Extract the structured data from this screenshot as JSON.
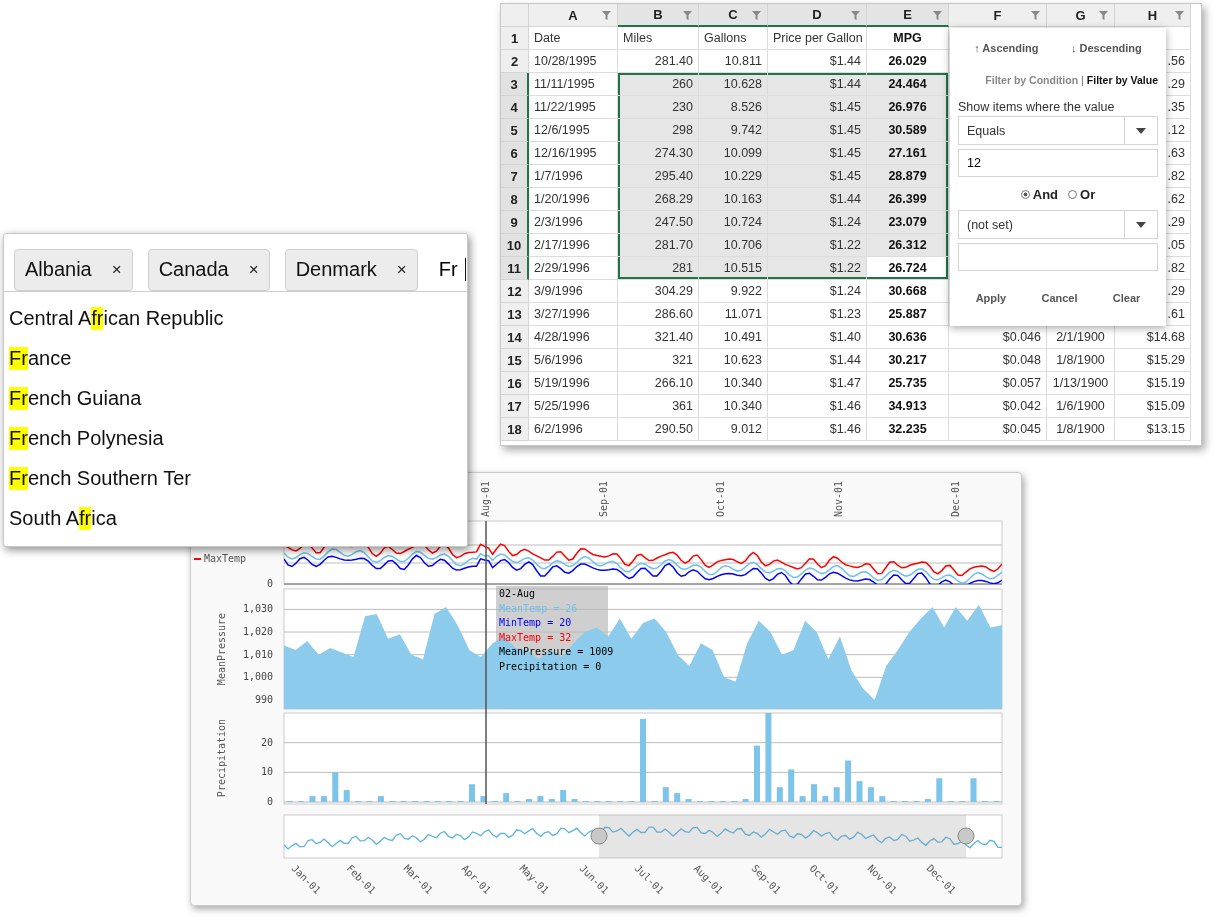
{
  "sheet": {
    "columns": [
      {
        "label": "A",
        "selected": false,
        "bold": false
      },
      {
        "label": "B",
        "selected": true,
        "bold": false
      },
      {
        "label": "C",
        "selected": true,
        "bold": false
      },
      {
        "label": "D",
        "selected": true,
        "bold": false
      },
      {
        "label": "E",
        "selected": true,
        "bold": true
      },
      {
        "label": "F",
        "selected": false,
        "bold": false
      },
      {
        "label": "G",
        "selected": false,
        "bold": false
      },
      {
        "label": "H",
        "selected": false,
        "bold": false
      }
    ],
    "rows": [
      {
        "header": "1",
        "selected": false,
        "cells": [
          {
            "text": "Date",
            "selected": false
          },
          {
            "text": "Miles",
            "selected": false
          },
          {
            "text": "Gallons",
            "selected": false
          },
          {
            "text": "Price per Gallon",
            "selected": false
          },
          {
            "text": "MPG",
            "selected": false
          },
          null,
          null,
          null
        ]
      },
      {
        "header": "2",
        "selected": false,
        "cells": [
          {
            "text": "10/28/1995",
            "selected": false
          },
          {
            "text": "281.40",
            "selected": false
          },
          {
            "text": "10.811",
            "selected": false
          },
          {
            "text": "$1.44",
            "selected": false
          },
          {
            "text": "26.029",
            "selected": false
          },
          null,
          null,
          {
            "text": ".56",
            "selected": false
          }
        ]
      },
      {
        "header": "3",
        "selected": true,
        "cells": [
          {
            "text": "11/11/1995",
            "selected": false
          },
          {
            "text": "260",
            "selected": true
          },
          {
            "text": "10.628",
            "selected": true
          },
          {
            "text": "$1.44",
            "selected": true
          },
          {
            "text": "24.464",
            "selected": true
          },
          null,
          null,
          {
            "text": ".29",
            "selected": false
          }
        ]
      },
      {
        "header": "4",
        "selected": true,
        "cells": [
          {
            "text": "11/22/1995",
            "selected": false
          },
          {
            "text": "230",
            "selected": true
          },
          {
            "text": "8.526",
            "selected": true
          },
          {
            "text": "$1.45",
            "selected": true
          },
          {
            "text": "26.976",
            "selected": true
          },
          null,
          null,
          {
            "text": ".35",
            "selected": false
          }
        ]
      },
      {
        "header": "5",
        "selected": true,
        "cells": [
          {
            "text": "12/6/1995",
            "selected": false
          },
          {
            "text": "298",
            "selected": true
          },
          {
            "text": "9.742",
            "selected": true
          },
          {
            "text": "$1.45",
            "selected": true
          },
          {
            "text": "30.589",
            "selected": true
          },
          null,
          null,
          {
            "text": ".12",
            "selected": false
          }
        ]
      },
      {
        "header": "6",
        "selected": true,
        "cells": [
          {
            "text": "12/16/1995",
            "selected": false
          },
          {
            "text": "274.30",
            "selected": true
          },
          {
            "text": "10.099",
            "selected": true
          },
          {
            "text": "$1.45",
            "selected": true
          },
          {
            "text": "27.161",
            "selected": true
          },
          null,
          null,
          {
            "text": ".63",
            "selected": false
          }
        ]
      },
      {
        "header": "7",
        "selected": true,
        "cells": [
          {
            "text": "1/7/1996",
            "selected": false
          },
          {
            "text": "295.40",
            "selected": true
          },
          {
            "text": "10.229",
            "selected": true
          },
          {
            "text": "$1.45",
            "selected": true
          },
          {
            "text": "28.879",
            "selected": true
          },
          null,
          null,
          {
            "text": ".82",
            "selected": false
          }
        ]
      },
      {
        "header": "8",
        "selected": true,
        "cells": [
          {
            "text": "1/20/1996",
            "selected": false
          },
          {
            "text": "268.29",
            "selected": true
          },
          {
            "text": "10.163",
            "selected": true
          },
          {
            "text": "$1.44",
            "selected": true
          },
          {
            "text": "26.399",
            "selected": true
          },
          null,
          null,
          {
            "text": ".62",
            "selected": false
          }
        ]
      },
      {
        "header": "9",
        "selected": true,
        "cells": [
          {
            "text": "2/3/1996",
            "selected": false
          },
          {
            "text": "247.50",
            "selected": true
          },
          {
            "text": "10.724",
            "selected": true
          },
          {
            "text": "$1.24",
            "selected": true
          },
          {
            "text": "23.079",
            "selected": true
          },
          null,
          null,
          {
            "text": ".29",
            "selected": false
          }
        ]
      },
      {
        "header": "10",
        "selected": true,
        "cells": [
          {
            "text": "2/17/1996",
            "selected": false
          },
          {
            "text": "281.70",
            "selected": true
          },
          {
            "text": "10.706",
            "selected": true
          },
          {
            "text": "$1.22",
            "selected": true
          },
          {
            "text": "26.312",
            "selected": true
          },
          null,
          null,
          {
            "text": ".05",
            "selected": false
          }
        ]
      },
      {
        "header": "11",
        "selected": true,
        "cells": [
          {
            "text": "2/29/1996",
            "selected": false
          },
          {
            "text": "281",
            "selected": true
          },
          {
            "text": "10.515",
            "selected": true
          },
          {
            "text": "$1.22",
            "selected": true
          },
          {
            "text": "26.724",
            "selected": false
          },
          null,
          null,
          {
            "text": ".82",
            "selected": false
          }
        ]
      },
      {
        "header": "12",
        "selected": false,
        "cells": [
          {
            "text": "3/9/1996",
            "selected": false
          },
          {
            "text": "304.29",
            "selected": false
          },
          {
            "text": "9.922",
            "selected": false
          },
          {
            "text": "$1.24",
            "selected": false
          },
          {
            "text": "30.668",
            "selected": false
          },
          null,
          null,
          {
            "text": ".29",
            "selected": false
          }
        ]
      },
      {
        "header": "13",
        "selected": false,
        "cells": [
          {
            "text": "3/27/1996",
            "selected": false
          },
          {
            "text": "286.60",
            "selected": false
          },
          {
            "text": "11.071",
            "selected": false
          },
          {
            "text": "$1.23",
            "selected": false
          },
          {
            "text": "25.887",
            "selected": false
          },
          null,
          null,
          {
            "text": ".61",
            "selected": false
          }
        ]
      },
      {
        "header": "14",
        "selected": false,
        "cells": [
          {
            "text": "4/28/1996",
            "selected": false
          },
          {
            "text": "321.40",
            "selected": false
          },
          {
            "text": "10.491",
            "selected": false
          },
          {
            "text": "$1.40",
            "selected": false
          },
          {
            "text": "30.636",
            "selected": false
          },
          {
            "text": "$0.046",
            "selected": false
          },
          {
            "text": "2/1/1900",
            "selected": false
          },
          {
            "text": "$14.68",
            "selected": false
          }
        ]
      },
      {
        "header": "15",
        "selected": false,
        "cells": [
          {
            "text": "5/6/1996",
            "selected": false
          },
          {
            "text": "321",
            "selected": false
          },
          {
            "text": "10.623",
            "selected": false
          },
          {
            "text": "$1.44",
            "selected": false
          },
          {
            "text": "30.217",
            "selected": false
          },
          {
            "text": "$0.048",
            "selected": false
          },
          {
            "text": "1/8/1900",
            "selected": false
          },
          {
            "text": "$15.29",
            "selected": false
          }
        ]
      },
      {
        "header": "16",
        "selected": false,
        "cells": [
          {
            "text": "5/19/1996",
            "selected": false
          },
          {
            "text": "266.10",
            "selected": false
          },
          {
            "text": "10.340",
            "selected": false
          },
          {
            "text": "$1.47",
            "selected": false
          },
          {
            "text": "25.735",
            "selected": false
          },
          {
            "text": "$0.057",
            "selected": false
          },
          {
            "text": "1/13/1900",
            "selected": false
          },
          {
            "text": "$15.19",
            "selected": false
          }
        ]
      },
      {
        "header": "17",
        "selected": false,
        "cells": [
          {
            "text": "5/25/1996",
            "selected": false
          },
          {
            "text": "361",
            "selected": false
          },
          {
            "text": "10.340",
            "selected": false
          },
          {
            "text": "$1.46",
            "selected": false
          },
          {
            "text": "34.913",
            "selected": false
          },
          {
            "text": "$0.042",
            "selected": false
          },
          {
            "text": "1/6/1900",
            "selected": false
          },
          {
            "text": "$15.09",
            "selected": false
          }
        ]
      },
      {
        "header": "18",
        "selected": false,
        "cells": [
          {
            "text": "6/2/1996",
            "selected": false
          },
          {
            "text": "290.50",
            "selected": false
          },
          {
            "text": "9.012",
            "selected": false
          },
          {
            "text": "$1.46",
            "selected": false
          },
          {
            "text": "32.235",
            "selected": false
          },
          {
            "text": "$0.045",
            "selected": false
          },
          {
            "text": "1/8/1900",
            "selected": false
          },
          {
            "text": "$13.15",
            "selected": false
          }
        ]
      }
    ]
  },
  "filter": {
    "sort": [
      "↑ Ascending",
      "↓ Descending"
    ],
    "tabs": [
      {
        "label": "Filter by Condition",
        "selected": false
      },
      {
        "label": "Filter by Value",
        "selected": true
      }
    ],
    "tab_separator": "|",
    "prompt": "Show items where the value",
    "condition": "Equals",
    "value": "12",
    "operators": [
      {
        "label": "And",
        "selected": true
      },
      {
        "label": "Or",
        "selected": false
      }
    ],
    "second_condition": "(not set)",
    "buttons": [
      "Apply",
      "Cancel",
      "Clear"
    ]
  },
  "tag_input": {
    "tags": [
      {
        "label": "Albania",
        "remove": "×"
      },
      {
        "label": "Canada",
        "remove": "×"
      },
      {
        "label": "Denmark",
        "remove": "×"
      }
    ],
    "value": "Fr",
    "suggestions": [
      {
        "before": "Central A",
        "match": "fr",
        "after": "ican Republic"
      },
      {
        "match": "Fr",
        "after": "ance"
      },
      {
        "match": "Fr",
        "after": "ench Guiana"
      },
      {
        "match": "Fr",
        "after": "ench Polynesia"
      },
      {
        "match": "Fr",
        "after": "ench Southern Ter"
      },
      {
        "before": "South A",
        "match": "fr",
        "after": "ica"
      }
    ]
  },
  "chart_panel": {
    "month_labels": [
      "Aug-01",
      "Sep-01",
      "Oct-01",
      "Nov-01",
      "Dec-01"
    ],
    "temperature": {
      "zero_tick": "0",
      "legend": [
        {
          "name": "MaxTemp",
          "color": "#ff0000"
        }
      ]
    },
    "tooltip": {
      "title": "02-Aug",
      "lines": [
        {
          "text": "MeanTemp = 26",
          "color": "#6ec1ea"
        },
        {
          "text": "MinTemp = 20",
          "color": "#0000ff"
        },
        {
          "text": "MaxTemp = 32",
          "color": "#ff0000"
        },
        {
          "text": "MeanPressure = 1009",
          "color": "#000000"
        },
        {
          "text": "Precipitation = 0",
          "color": "#000000"
        }
      ]
    },
    "pressure": {
      "chart_data": {
        "type": "area",
        "categories": [
          null,
          null,
          null,
          null,
          null,
          null,
          null,
          null,
          null,
          null,
          null,
          null,
          null,
          null,
          null,
          null,
          null,
          null,
          null,
          null,
          null,
          null,
          null,
          null,
          null,
          null,
          null,
          null,
          null,
          null,
          null,
          null,
          null,
          null,
          null,
          null,
          null,
          null,
          null,
          null,
          null,
          null,
          null,
          null,
          null,
          null,
          null,
          null,
          null,
          null,
          null,
          null,
          null,
          null,
          null,
          null,
          null,
          null,
          null,
          null,
          null,
          null,
          null
        ],
        "series": [
          {
            "name": "MeanPressure",
            "color": "#8ccbec",
            "values": [
              1014,
              1012,
              1016,
              1010,
              1013,
              1011,
              1009,
              1027,
              1028,
              1017,
              1019,
              1010,
              1008,
              1028,
              1031,
              1023,
              1012,
              1009,
              1015,
              1018,
              1013,
              1012,
              1008,
              1012,
              1009,
              1015,
              1020,
              1022,
              1018,
              1026,
              1017,
              1024,
              1026,
              1020,
              1010,
              1005,
              1015,
              1012,
              1000,
              998,
              1015,
              1025,
              1020,
              1010,
              1012,
              1025,
              1020,
              1008,
              1018,
              1003,
              995,
              990,
              1005,
              1012,
              1020,
              1026,
              1031,
              1022,
              1031,
              1025,
              1032,
              1022,
              1023
            ]
          }
        ],
        "ylim": [
          986,
          1039
        ],
        "grid": true,
        "yticks": [
          {
            "value": 990,
            "label": "990"
          },
          {
            "value": 1000,
            "label": "1,000"
          },
          {
            "value": 1010,
            "label": "1,010"
          },
          {
            "value": 1020,
            "label": "1,020"
          },
          {
            "value": 1030,
            "label": "1,030"
          }
        ]
      }
    },
    "precipitation": {
      "chart_data": {
        "type": "bar",
        "categories": [
          null,
          null,
          null,
          null,
          null,
          null,
          null,
          null,
          null,
          null,
          null,
          null,
          null,
          null,
          null,
          null,
          null,
          null,
          null,
          null,
          null,
          null,
          null,
          null,
          null,
          null,
          null,
          null,
          null,
          null,
          null,
          null,
          null,
          null,
          null,
          null,
          null,
          null,
          null,
          null,
          null,
          null,
          null,
          null,
          null,
          null,
          null,
          null,
          null,
          null,
          null,
          null,
          null,
          null,
          null,
          null,
          null,
          null,
          null,
          null,
          null,
          null,
          null
        ],
        "series": [
          {
            "name": "Precipitation",
            "color": "#7cc4ea",
            "values": [
              0,
              0,
              2,
              2,
              10,
              4,
              0,
              0,
              2,
              0,
              0,
              0,
              0,
              0,
              0,
              0,
              6,
              2,
              0,
              3,
              0,
              1,
              2,
              1,
              4,
              1,
              0,
              0,
              0,
              0,
              0,
              28,
              0,
              5,
              3,
              1,
              0,
              0,
              0,
              0,
              1,
              19,
              30,
              5,
              11,
              2,
              6,
              2,
              5,
              14,
              7,
              5,
              2,
              0,
              0,
              0,
              1,
              8,
              0,
              0,
              8,
              0,
              0
            ]
          }
        ],
        "ylim": [
          0,
          30
        ],
        "grid": true,
        "yticks": [
          {
            "value": 0,
            "label": "0"
          },
          {
            "value": 10,
            "label": "10"
          },
          {
            "value": 20,
            "label": "20"
          }
        ]
      }
    },
    "navigator": {
      "month_labels": [
        "Jan-01",
        "Feb-01",
        "Mar-01",
        "Apr-01",
        "May-01",
        "Jun-01",
        "Jul-01",
        "Aug-01",
        "Sep-01",
        "Oct-01",
        "Nov-01",
        "Dec-01"
      ]
    }
  }
}
